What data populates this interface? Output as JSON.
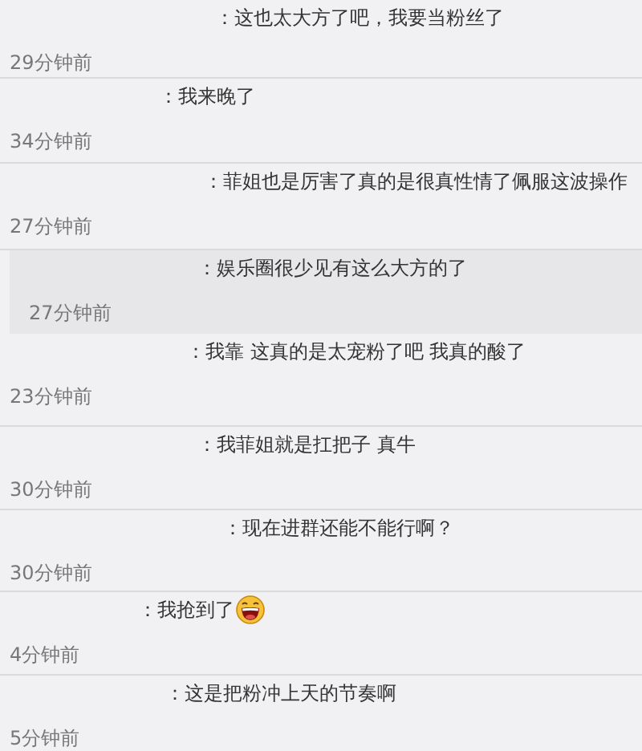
{
  "comments": [
    {
      "text": "：这也太大方了吧，我要当粉丝了",
      "time": "29分钟前",
      "highlighted": false,
      "emoticon": false
    },
    {
      "text": "：我来晚了",
      "time": "34分钟前",
      "highlighted": false,
      "emoticon": false
    },
    {
      "text": "：菲姐也是厉害了真的是很真性情了佩服这波操作",
      "time": "27分钟前",
      "highlighted": false,
      "emoticon": false
    },
    {
      "text": "：娱乐圈很少见有这么大方的了",
      "time": "27分钟前",
      "highlighted": true,
      "emoticon": false
    },
    {
      "text": "：我靠 这真的是太宠粉了吧 我真的酸了",
      "time": "23分钟前",
      "highlighted": false,
      "emoticon": false
    },
    {
      "text": "：我菲姐就是扛把子  真牛",
      "time": "30分钟前",
      "highlighted": false,
      "emoticon": false
    },
    {
      "text": "：现在进群还能不能行啊？",
      "time": "30分钟前",
      "highlighted": false,
      "emoticon": false
    },
    {
      "text": "：我抢到了",
      "time": "4分钟前",
      "highlighted": false,
      "emoticon": true
    },
    {
      "text": "：这是把粉冲上天的节奏啊",
      "time": "5分钟前",
      "highlighted": false,
      "emoticon": false
    }
  ]
}
